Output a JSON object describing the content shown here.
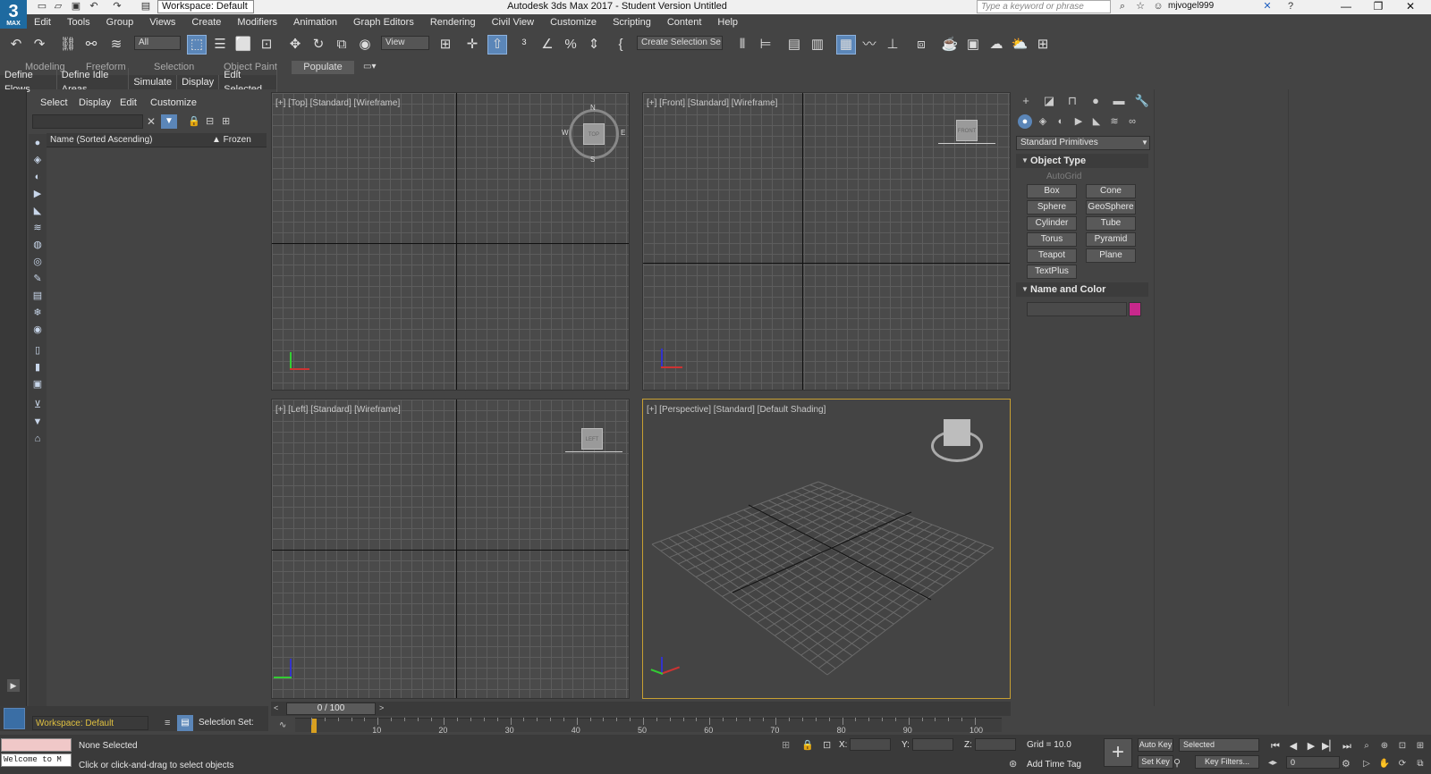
{
  "app": {
    "title": "Autodesk 3ds Max 2017 - Student Version   Untitled",
    "logo": "3",
    "logo_sub": "MAX",
    "workspace": "Workspace: Default",
    "search_placeholder": "Type a keyword or phrase",
    "user": "mjvogel999"
  },
  "menu": [
    "Edit",
    "Tools",
    "Group",
    "Views",
    "Create",
    "Modifiers",
    "Animation",
    "Graph Editors",
    "Rendering",
    "Civil View",
    "Customize",
    "Scripting",
    "Content",
    "Help"
  ],
  "toolbar": {
    "filter_value": "All",
    "ref_coord_value": "View",
    "selection_set_value": "Create Selection Se"
  },
  "ribbon": {
    "tabs": [
      "Modeling",
      "Freeform",
      "Selection",
      "Object Paint"
    ],
    "active_tab": "Populate",
    "sub_items": [
      "Define Flows",
      "Define Idle Areas",
      "Simulate",
      "Display",
      "Edit Selected"
    ]
  },
  "scene_explorer": {
    "menu": [
      "Select",
      "Display",
      "Edit",
      "Customize"
    ],
    "col_name": "Name (Sorted Ascending)",
    "col_frozen": "▲ Frozen"
  },
  "viewports": {
    "top": "[+] [Top] [Standard] [Wireframe]",
    "front": "[+] [Front] [Standard] [Wireframe]",
    "left": "[+] [Left] [Standard] [Wireframe]",
    "persp": "[+] [Perspective] [Standard] [Default Shading]",
    "compass": {
      "n": "N",
      "s": "S",
      "e": "E",
      "w": "W"
    }
  },
  "command_panel": {
    "category": "Standard Primitives",
    "object_type_title": "Object Type",
    "autogrid": "AutoGrid",
    "primitives": [
      "Box",
      "Cone",
      "Sphere",
      "GeoSphere",
      "Cylinder",
      "Tube",
      "Torus",
      "Pyramid",
      "Teapot",
      "Plane",
      "TextPlus"
    ],
    "name_color_title": "Name and Color",
    "object_color": "#c8288c"
  },
  "timeline": {
    "frame_display": "0 / 100",
    "ticks": [
      "10",
      "20",
      "30",
      "40",
      "50",
      "60",
      "70",
      "80",
      "90",
      "100"
    ]
  },
  "bottom_left": {
    "workspace": "Workspace: Default",
    "selection_set": "Selection Set:"
  },
  "status": {
    "maxscript_text": "Welcome to M",
    "selection": "None Selected",
    "prompt": "Click or click-and-drag to select objects",
    "x_label": "X:",
    "y_label": "Y:",
    "z_label": "Z:",
    "grid": "Grid = 10.0",
    "add_time_tag": "Add Time Tag",
    "auto_key": "Auto Key",
    "set_key": "Set Key",
    "key_mode": "Selected",
    "key_filters": "Key Filters...",
    "current_frame": "0"
  }
}
